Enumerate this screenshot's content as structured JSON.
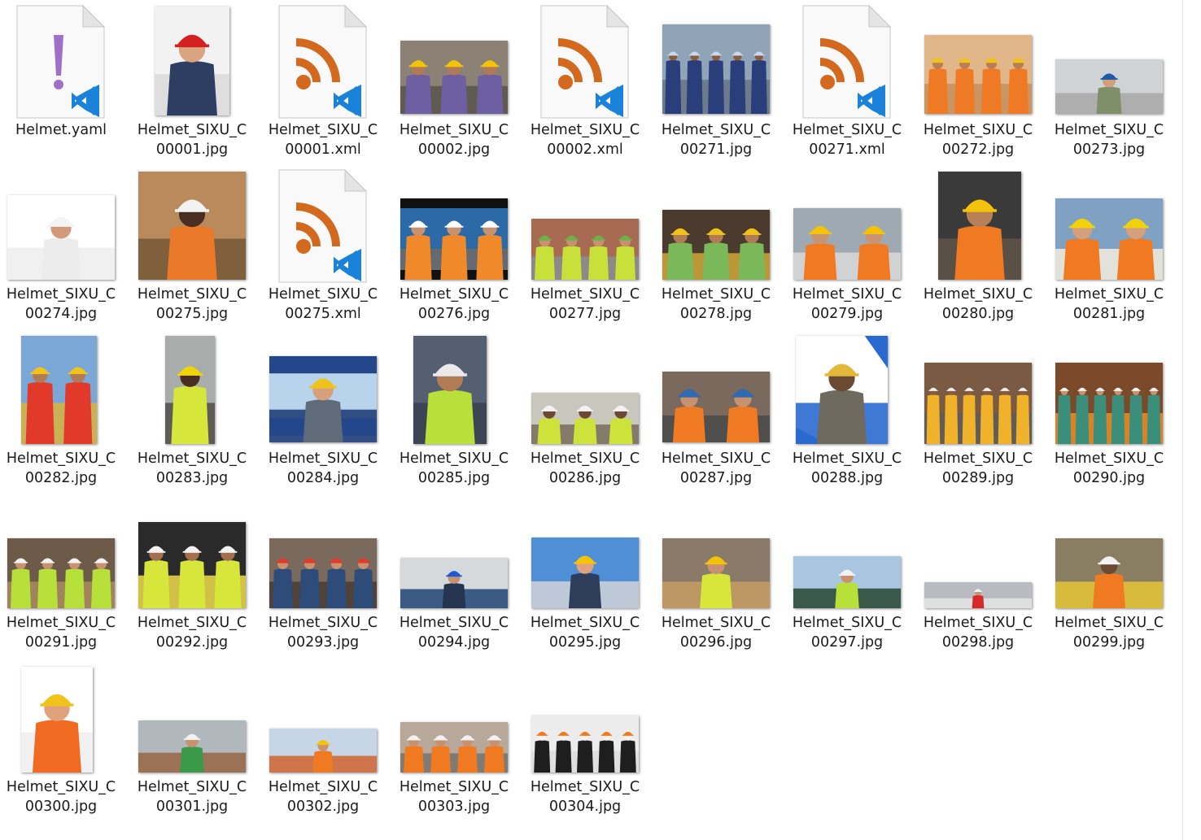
{
  "colors": {
    "rss_orange": "#d2691e",
    "vscode_blue": "#1a82d8",
    "yaml_purple": "#a070c8",
    "label_text": "#1a1a1a"
  },
  "files": [
    {
      "name": "Helmet.yaml",
      "line1": "Helmet.yaml",
      "line2": "",
      "kind": "yaml",
      "icon": "yaml-vscode-icon"
    },
    {
      "name": "Helmet_SIXU_C00001.jpg",
      "line1": "Helmet_SIXU_C",
      "line2": "00001.jpg",
      "kind": "jpg",
      "icon": "worker-red-helmet-photo"
    },
    {
      "name": "Helmet_SIXU_C00001.xml",
      "line1": "Helmet_SIXU_C",
      "line2": "00001.xml",
      "kind": "xml",
      "icon": "rss-vscode-icon"
    },
    {
      "name": "Helmet_SIXU_C00002.jpg",
      "line1": "Helmet_SIXU_C",
      "line2": "00002.jpg",
      "kind": "jpg",
      "icon": "workers-yellow-helmets-photo"
    },
    {
      "name": "Helmet_SIXU_C00002.xml",
      "line1": "Helmet_SIXU_C",
      "line2": "00002.xml",
      "kind": "xml",
      "icon": "rss-vscode-icon"
    },
    {
      "name": "Helmet_SIXU_C00271.jpg",
      "line1": "Helmet_SIXU_C",
      "line2": "00271.jpg",
      "kind": "jpg",
      "icon": "workers-group-photo"
    },
    {
      "name": "Helmet_SIXU_C00271.xml",
      "line1": "Helmet_SIXU_C",
      "line2": "00271.xml",
      "kind": "xml",
      "icon": "rss-vscode-icon"
    },
    {
      "name": "Helmet_SIXU_C00272.jpg",
      "line1": "Helmet_SIXU_C",
      "line2": "00272.jpg",
      "kind": "jpg",
      "icon": "workers-team-photo"
    },
    {
      "name": "Helmet_SIXU_C00273.jpg",
      "line1": "Helmet_SIXU_C",
      "line2": "00273.jpg",
      "kind": "jpg",
      "icon": "worker-blue-helmet-photo"
    },
    {
      "name": "Helmet_SIXU_C00274.jpg",
      "line1": "Helmet_SIXU_C",
      "line2": "00274.jpg",
      "kind": "jpg",
      "icon": "man-white-helmet-photo"
    },
    {
      "name": "Helmet_SIXU_C00275.jpg",
      "line1": "Helmet_SIXU_C",
      "line2": "00275.jpg",
      "kind": "jpg",
      "icon": "worker-orange-shirt-photo"
    },
    {
      "name": "Helmet_SIXU_C00275.xml",
      "line1": "Helmet_SIXU_C",
      "line2": "00275.xml",
      "kind": "xml",
      "icon": "rss-vscode-icon"
    },
    {
      "name": "Helmet_SIXU_C00276.jpg",
      "line1": "Helmet_SIXU_C",
      "line2": "00276.jpg",
      "kind": "jpg",
      "icon": "project-innovation-photo"
    },
    {
      "name": "Helmet_SIXU_C00277.jpg",
      "line1": "Helmet_SIXU_C",
      "line2": "00277.jpg",
      "kind": "jpg",
      "icon": "workers-vests-back-photo"
    },
    {
      "name": "Helmet_SIXU_C00278.jpg",
      "line1": "Helmet_SIXU_C",
      "line2": "00278.jpg",
      "kind": "jpg",
      "icon": "rebar-workers-photo"
    },
    {
      "name": "Helmet_SIXU_C00279.jpg",
      "line1": "Helmet_SIXU_C",
      "line2": "00279.jpg",
      "kind": "jpg",
      "icon": "workers-blueprints-photo"
    },
    {
      "name": "Helmet_SIXU_C00280.jpg",
      "line1": "Helmet_SIXU_C",
      "line2": "00280.jpg",
      "kind": "jpg",
      "icon": "worker-standing-photo"
    },
    {
      "name": "Helmet_SIXU_C00281.jpg",
      "line1": "Helmet_SIXU_C",
      "line2": "00281.jpg",
      "kind": "jpg",
      "icon": "workers-reading-plans-photo"
    },
    {
      "name": "Helmet_SIXU_C00282.jpg",
      "line1": "Helmet_SIXU_C",
      "line2": "00282.jpg",
      "kind": "jpg",
      "icon": "collage-excavator-photo"
    },
    {
      "name": "Helmet_SIXU_C00283.jpg",
      "line1": "Helmet_SIXU_C",
      "line2": "00283.jpg",
      "kind": "jpg",
      "icon": "worker-full-body-photo"
    },
    {
      "name": "Helmet_SIXU_C00284.jpg",
      "line1": "Helmet_SIXU_C",
      "line2": "00284.jpg",
      "kind": "jpg",
      "icon": "hard-hat-poster-photo"
    },
    {
      "name": "Helmet_SIXU_C00285.jpg",
      "line1": "Helmet_SIXU_C",
      "line2": "00285.jpg",
      "kind": "jpg",
      "icon": "worker-back-view-photo"
    },
    {
      "name": "Helmet_SIXU_C00286.jpg",
      "line1": "Helmet_SIXU_C",
      "line2": "00286.jpg",
      "kind": "jpg",
      "icon": "workers-site-photo"
    },
    {
      "name": "Helmet_SIXU_C00287.jpg",
      "line1": "Helmet_SIXU_C",
      "line2": "00287.jpg",
      "kind": "jpg",
      "icon": "workers-containers-photo"
    },
    {
      "name": "Helmet_SIXU_C00288.jpg",
      "line1": "Helmet_SIXU_C",
      "line2": "00288.jpg",
      "kind": "jpg",
      "icon": "worker-tablet-photo"
    },
    {
      "name": "Helmet_SIXU_C00289.jpg",
      "line1": "Helmet_SIXU_C",
      "line2": "00289.jpg",
      "kind": "jpg",
      "icon": "workers-mural-photo"
    },
    {
      "name": "Helmet_SIXU_C00290.jpg",
      "line1": "Helmet_SIXU_C",
      "line2": "00290.jpg",
      "kind": "jpg",
      "icon": "workers-furnace-photo"
    },
    {
      "name": "Helmet_SIXU_C00291.jpg",
      "line1": "Helmet_SIXU_C",
      "line2": "00291.jpg",
      "kind": "jpg",
      "icon": "rebar-site-photo"
    },
    {
      "name": "Helmet_SIXU_C00292.jpg",
      "line1": "Helmet_SIXU_C",
      "line2": "00292.jpg",
      "kind": "jpg",
      "icon": "workers-smiling-photo"
    },
    {
      "name": "Helmet_SIXU_C00293.jpg",
      "line1": "Helmet_SIXU_C",
      "line2": "00293.jpg",
      "kind": "jpg",
      "icon": "workers-scaffold-photo"
    },
    {
      "name": "Helmet_SIXU_C00294.jpg",
      "line1": "Helmet_SIXU_C",
      "line2": "00294.jpg",
      "kind": "jpg",
      "icon": "worker-earmuffs-photo"
    },
    {
      "name": "Helmet_SIXU_C00295.jpg",
      "line1": "Helmet_SIXU_C",
      "line2": "00295.jpg",
      "kind": "jpg",
      "icon": "worker-thumbs-up-photo"
    },
    {
      "name": "Helmet_SIXU_C00296.jpg",
      "line1": "Helmet_SIXU_C",
      "line2": "00296.jpg",
      "kind": "jpg",
      "icon": "worker-carrying-wood-photo"
    },
    {
      "name": "Helmet_SIXU_C00297.jpg",
      "line1": "Helmet_SIXU_C",
      "line2": "00297.jpg",
      "kind": "jpg",
      "icon": "safety-sign-photo"
    },
    {
      "name": "Helmet_SIXU_C00298.jpg",
      "line1": "Helmet_SIXU_C",
      "line2": "00298.jpg",
      "kind": "jpg",
      "icon": "worker-red-jacket-photo"
    },
    {
      "name": "Helmet_SIXU_C00299.jpg",
      "line1": "Helmet_SIXU_C",
      "line2": "00299.jpg",
      "kind": "jpg",
      "icon": "worker-excavator-photo"
    },
    {
      "name": "Helmet_SIXU_C00300.jpg",
      "line1": "Helmet_SIXU_C",
      "line2": "00300.jpg",
      "kind": "jpg",
      "icon": "worker-orange-vest-photo"
    },
    {
      "name": "Helmet_SIXU_C00301.jpg",
      "line1": "Helmet_SIXU_C",
      "line2": "00301.jpg",
      "kind": "jpg",
      "icon": "worker-harness-photo"
    },
    {
      "name": "Helmet_SIXU_C00302.jpg",
      "line1": "Helmet_SIXU_C",
      "line2": "00302.jpg",
      "kind": "jpg",
      "icon": "worker-truss-photo"
    },
    {
      "name": "Helmet_SIXU_C00303.jpg",
      "line1": "Helmet_SIXU_C",
      "line2": "00303.jpg",
      "kind": "jpg",
      "icon": "road-workers-photo"
    },
    {
      "name": "Helmet_SIXU_C00304.jpg",
      "line1": "Helmet_SIXU_C",
      "line2": "00304.jpg",
      "kind": "jpg",
      "icon": "helmets-wall-photo"
    }
  ]
}
